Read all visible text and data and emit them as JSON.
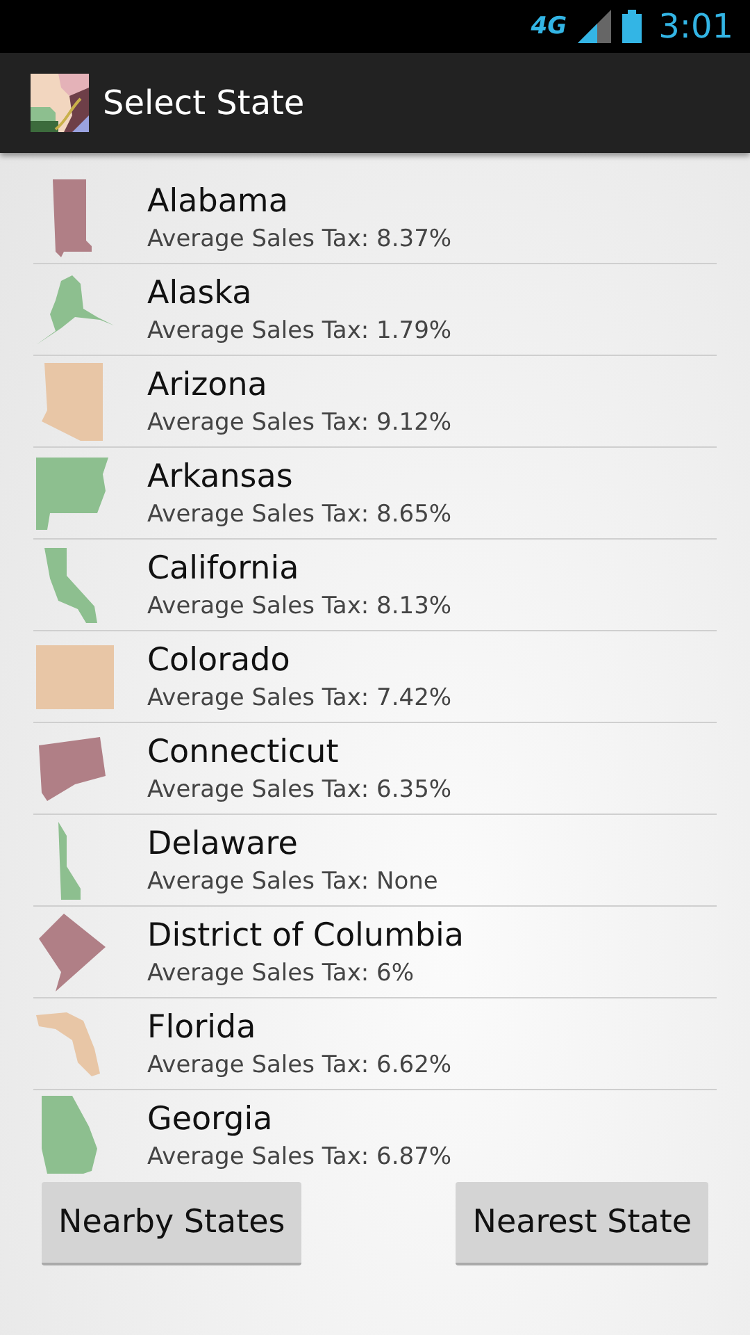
{
  "status_bar": {
    "network": "4G",
    "time": "3:01"
  },
  "action_bar": {
    "title": "Select State"
  },
  "states": [
    {
      "name": "Alabama",
      "tax": "Average Sales Tax: 8.37%",
      "color": "#b07f86"
    },
    {
      "name": "Alaska",
      "tax": "Average Sales Tax: 1.79%",
      "color": "#8dbf8f"
    },
    {
      "name": "Arizona",
      "tax": "Average Sales Tax: 9.12%",
      "color": "#e8c6a6"
    },
    {
      "name": "Arkansas",
      "tax": "Average Sales Tax: 8.65%",
      "color": "#8dbf8f"
    },
    {
      "name": "California",
      "tax": "Average Sales Tax: 8.13%",
      "color": "#8dbf8f"
    },
    {
      "name": "Colorado",
      "tax": "Average Sales Tax: 7.42%",
      "color": "#e8c6a6"
    },
    {
      "name": "Connecticut",
      "tax": "Average Sales Tax: 6.35%",
      "color": "#b07f86"
    },
    {
      "name": "Delaware",
      "tax": "Average Sales Tax: None",
      "color": "#8dbf8f"
    },
    {
      "name": "District of Columbia",
      "tax": "Average Sales Tax: 6%",
      "color": "#b07f86"
    },
    {
      "name": "Florida",
      "tax": "Average Sales Tax: 6.62%",
      "color": "#e8c6a6"
    },
    {
      "name": "Georgia",
      "tax": "Average Sales Tax: 6.87%",
      "color": "#8dbf8f"
    }
  ],
  "buttons": [
    "Nearby States",
    "Nearest State"
  ]
}
